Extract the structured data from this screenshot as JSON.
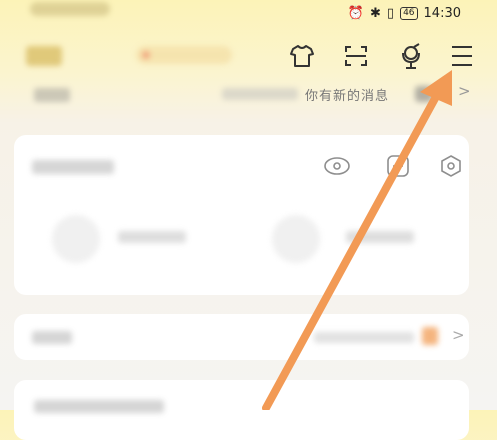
{
  "status_bar": {
    "time": "14:30",
    "battery": "46"
  },
  "message_row": {
    "text": "你有新的消息",
    "chevron": ">"
  },
  "accent_colors": {
    "arrow": "#f29a55",
    "background_top": "#fcf3b8"
  },
  "icons": [
    "tshirt-icon",
    "scan-icon",
    "mic-icon",
    "menu-icon",
    "settings-icon",
    "eye-icon",
    "add-icon"
  ]
}
